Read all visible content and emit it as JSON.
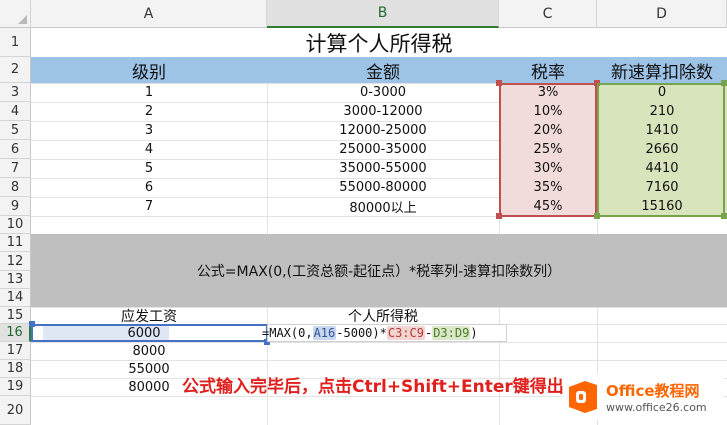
{
  "columns": [
    "A",
    "B",
    "C",
    "D"
  ],
  "rows": [
    "1",
    "2",
    "3",
    "4",
    "5",
    "6",
    "7",
    "8",
    "9",
    "10",
    "11",
    "12",
    "13",
    "14",
    "15",
    "16",
    "17",
    "18",
    "19",
    "20"
  ],
  "title": "计算个人所得税",
  "table_headers": [
    "级别",
    "金额",
    "税率",
    "新速算扣除数"
  ],
  "table_rows": [
    [
      "1",
      "0-3000",
      "3%",
      "0"
    ],
    [
      "2",
      "3000-12000",
      "10%",
      "210"
    ],
    [
      "3",
      "12000-25000",
      "20%",
      "1410"
    ],
    [
      "4",
      "25000-35000",
      "25%",
      "2660"
    ],
    [
      "5",
      "35000-55000",
      "30%",
      "4410"
    ],
    [
      "6",
      "55000-80000",
      "35%",
      "7160"
    ],
    [
      "7",
      "80000以上",
      "45%",
      "15160"
    ]
  ],
  "formula_note": "公式=MAX(0,(工资总额-起征点）*税率列-速算扣除数列）",
  "salary_header": "应发工资",
  "tax_header": "个人所得税",
  "salaries": [
    "6000",
    "8000",
    "55000",
    "80000"
  ],
  "formula_parts": [
    "=MAX(0,",
    "A16",
    "-5000)*",
    "C3:C9",
    "-",
    "D3:D9",
    ")"
  ],
  "instruction": "公式输入完毕后，点击Ctrl+Shift+Enter键得出结果",
  "logo": {
    "brand": "Office教程网",
    "url": "www.office26.com"
  },
  "colors": {
    "header_band": "#9dc3e6",
    "gray_band": "#bfbfbf",
    "rate_fill": "#f2dcdb",
    "deduct_fill": "#d8e4bc",
    "note_red": "#e0201c",
    "logo_orange": "#ff6600"
  }
}
